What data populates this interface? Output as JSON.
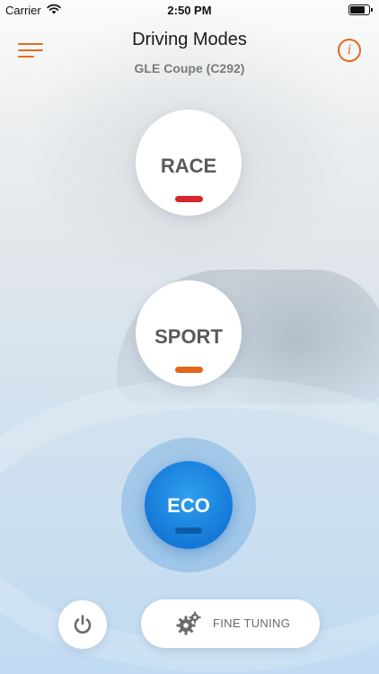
{
  "status_bar": {
    "carrier": "Carrier",
    "time": "2:50 PM",
    "wifi_icon": "wifi-icon",
    "battery_icon": "battery-icon"
  },
  "header": {
    "title": "Driving Modes",
    "subtitle": "GLE Coupe (C292)",
    "menu_icon": "hamburger-menu-icon",
    "info_icon": "info-icon",
    "info_glyph": "i"
  },
  "modes": [
    {
      "label": "RACE",
      "indicator_color": "#d7262e",
      "selected": false
    },
    {
      "label": "SPORT",
      "indicator_color": "#e5671c",
      "selected": false
    },
    {
      "label": "ECO",
      "indicator_color": "#0f5aa8",
      "selected": true
    }
  ],
  "controls": {
    "power_icon": "power-icon",
    "fine_tuning_icon": "gears-icon",
    "fine_tuning_label": "FINE TUNING"
  },
  "colors": {
    "accent": "#e56b1f",
    "eco_blue": "#1a86e0"
  }
}
